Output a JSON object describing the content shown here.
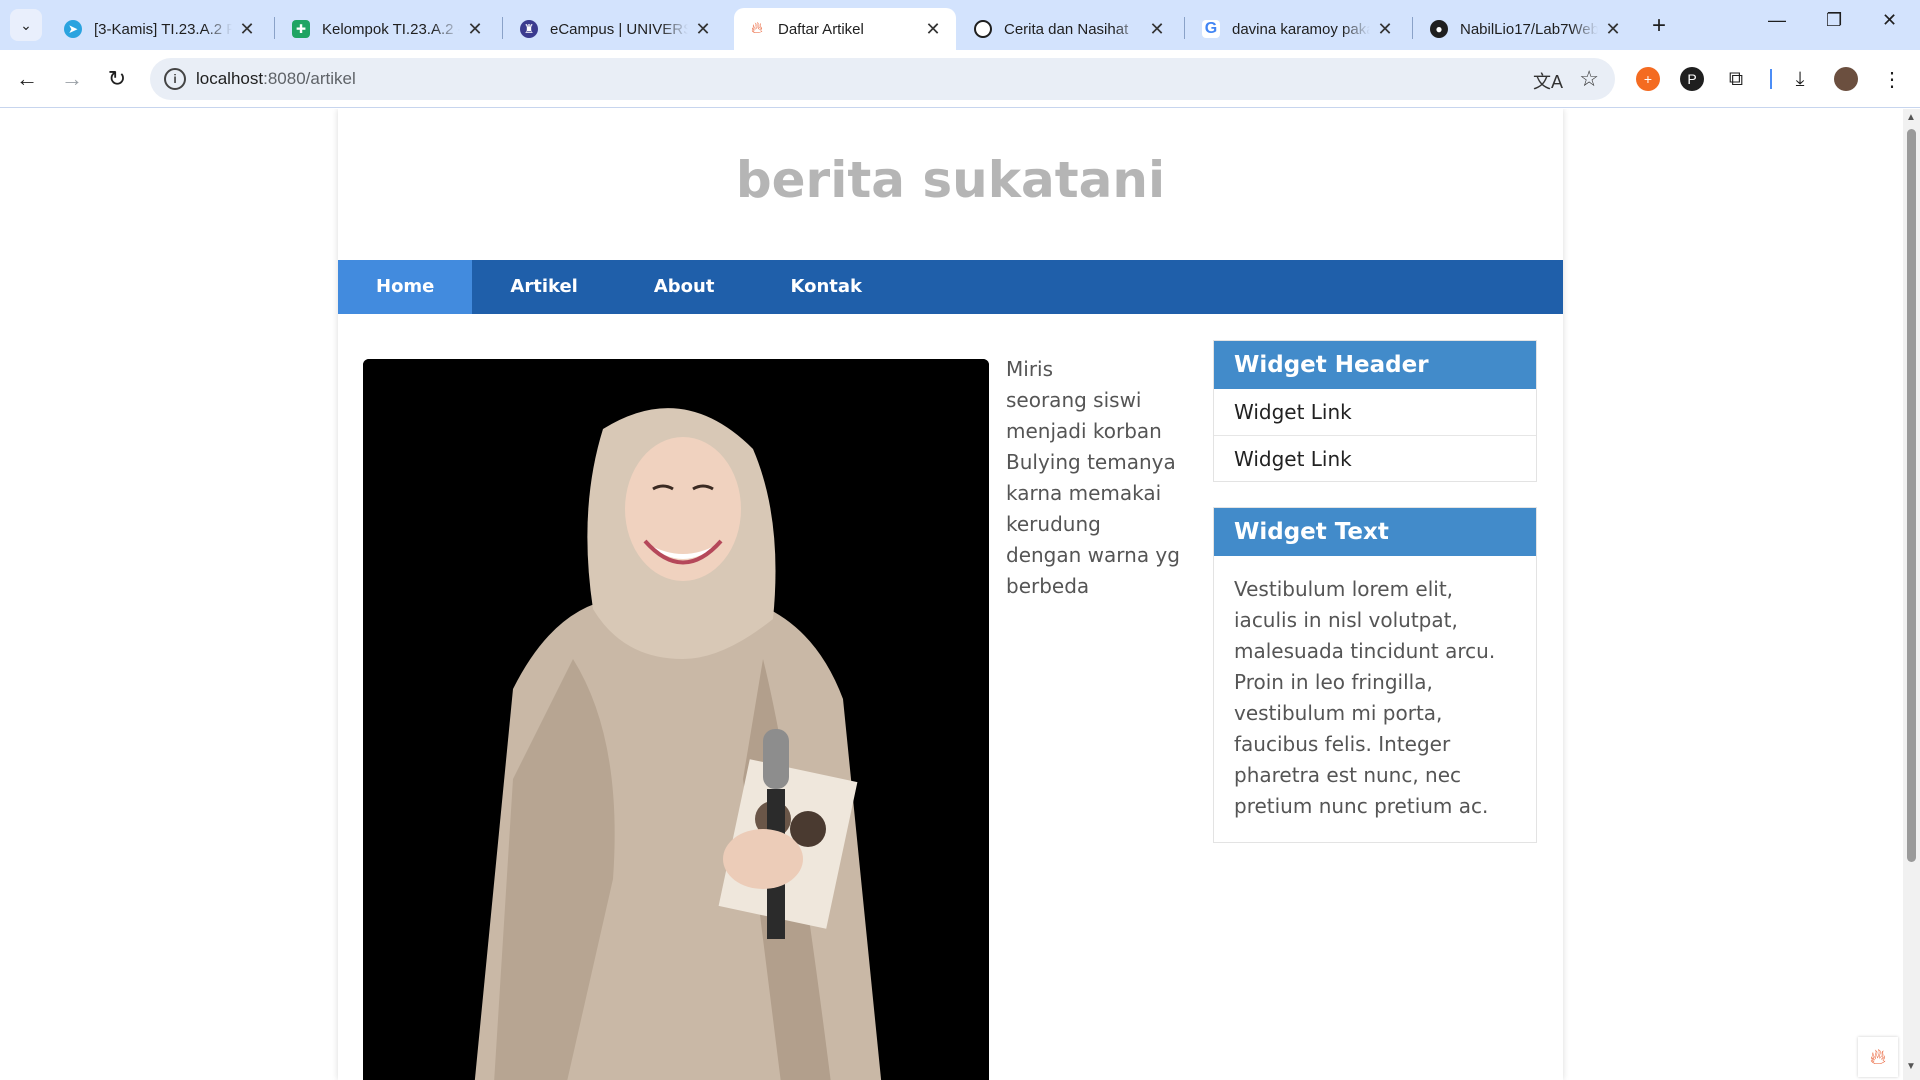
{
  "browser": {
    "tabs": [
      {
        "title": "[3-Kamis] TI.23.A.2 Pe",
        "icon": "telegram-icon",
        "color": "#2aa3df"
      },
      {
        "title": "Kelompok TI.23.A.2 -",
        "icon": "sheets-icon",
        "color": "#1fa463"
      },
      {
        "title": "eCampus | UNIVERSI",
        "icon": "campus-icon",
        "color": "#3b3b8f"
      },
      {
        "title": "Daftar Artikel",
        "icon": "flame-icon",
        "color": "#e8572a"
      },
      {
        "title": "Cerita dan Nasihat",
        "icon": "chatgpt-icon",
        "color": "#1f1f1f"
      },
      {
        "title": "davina karamoy paka",
        "icon": "google-icon",
        "color": "#4285f4"
      },
      {
        "title": "NabilLio17/Lab7Web",
        "icon": "github-icon",
        "color": "#1f1f1f"
      }
    ],
    "url_host": "localhost",
    "url_path": ":8080/artikel"
  },
  "site": {
    "title": "berita sukatani",
    "nav": [
      "Home",
      "Artikel",
      "About",
      "Kontak"
    ]
  },
  "article": {
    "lead": "Miris",
    "text": "seorang siswi menjadi korban Bulying temanya karna memakai kerudung dengan warna yg berbeda"
  },
  "widgets": {
    "links_header": "Widget Header",
    "links": [
      "Widget Link",
      "Widget Link"
    ],
    "text_header": "Widget Text",
    "text_body": "Vestibulum lorem elit, iaculis in nisl volutpat, malesuada tincidunt arcu. Proin in leo fringilla, vestibulum mi porta, faucibus felis. Integer pharetra est nunc, nec pretium nunc pretium ac."
  },
  "colors": {
    "nav_bg": "#1f5faa",
    "nav_active": "#428bde",
    "widget_header": "#428bca",
    "title_gray": "#b5b5b5"
  }
}
